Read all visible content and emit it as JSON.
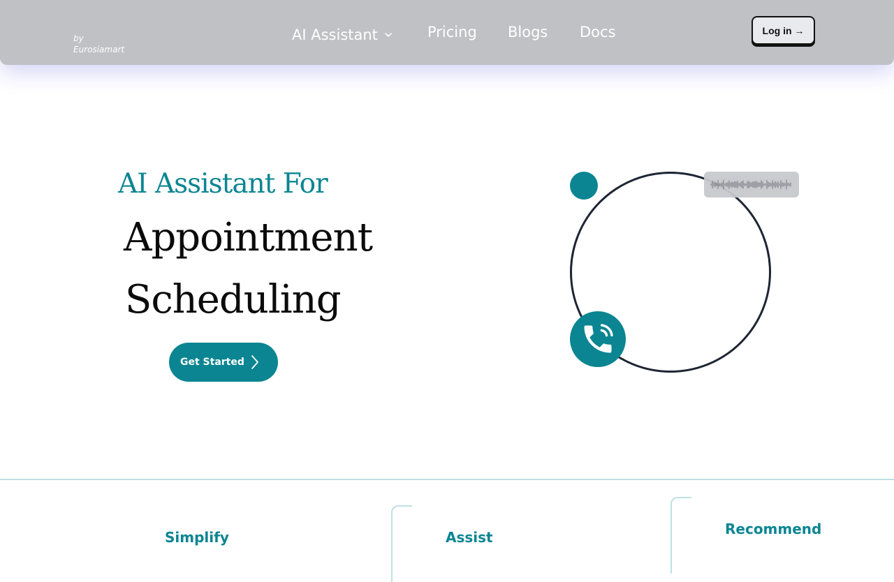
{
  "header": {
    "brand_sub": [
      "by",
      "Eurosiamart"
    ],
    "nav": {
      "ai_assistant": "AI Assistant",
      "pricing": "Pricing",
      "blogs": "Blogs",
      "docs": "Docs"
    },
    "login_label": "Log in →"
  },
  "hero": {
    "kicker": "AI Assistant For",
    "line1": "Appointment",
    "line2": "Scheduling",
    "cta_label": "Get Started"
  },
  "features": {
    "simplify": "Simplify",
    "assist": "Assist",
    "recommend": "Recommend"
  },
  "icons": {
    "dropdown": "chevron-down-icon",
    "cta_arrow": "chevron-right-icon",
    "phone": "phone-call-icon",
    "waveform": "audio-waveform-icon"
  },
  "colors": {
    "accent": "#0b8592",
    "header_bg": "#c0c1c5",
    "circle_stroke": "#1e2533"
  }
}
